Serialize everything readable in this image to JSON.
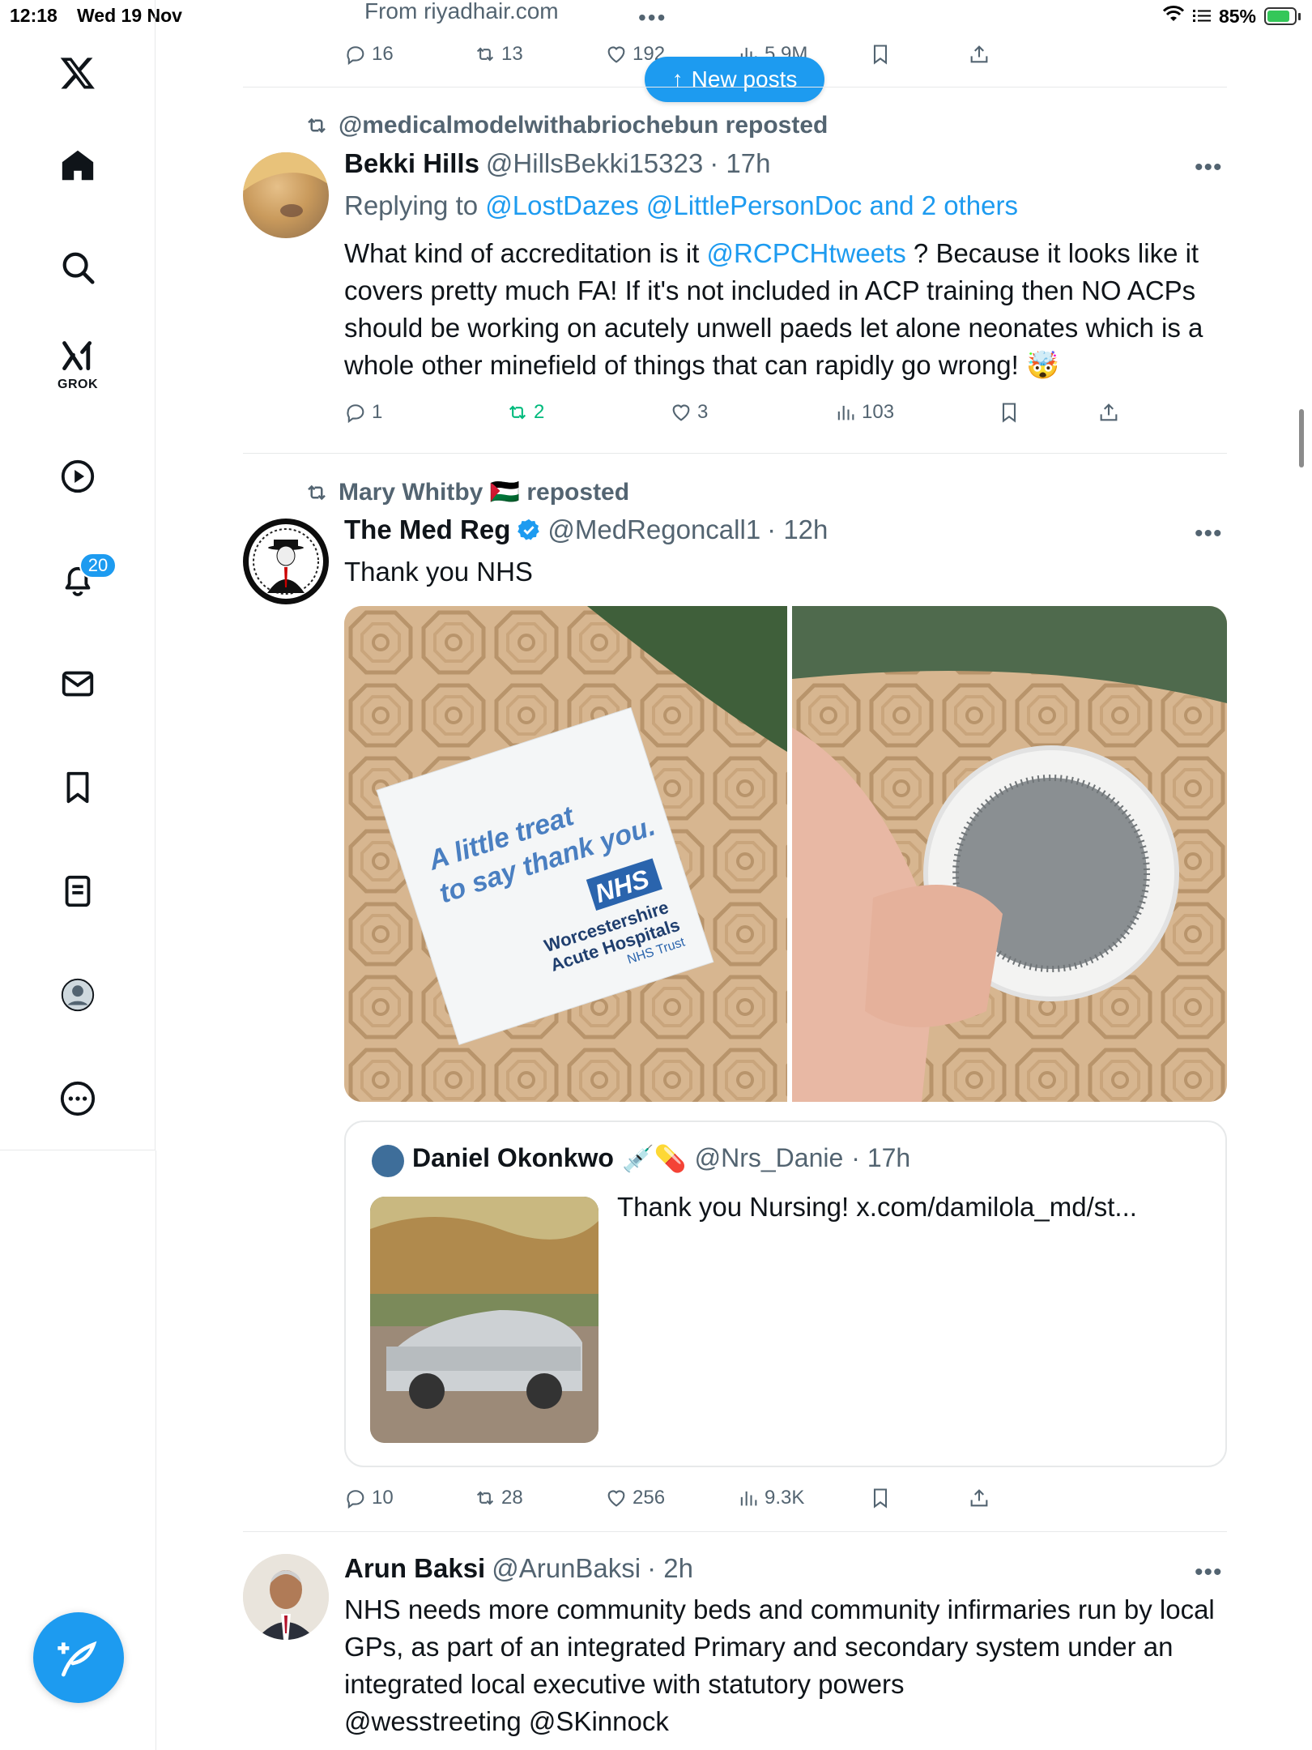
{
  "status": {
    "time": "12:18",
    "date": "Wed 19 Nov",
    "battery": "85%",
    "battery_level": 0.85
  },
  "sidebar": {
    "grok_label": "GROK",
    "notifications_badge": "20"
  },
  "top_tweet": {
    "source": "From riyadhair.com",
    "replies": "16",
    "reposts": "13",
    "likes": "192",
    "views": "5.9M"
  },
  "new_posts": "New posts",
  "tweet1": {
    "repost_by": "@medicalmodelwithabriochebun reposted",
    "name": "Bekki Hills",
    "handle": "@HillsBekki15323",
    "time": "· 17h",
    "reply_prefix": "Replying to",
    "reply_to": "@LostDazes @LittlePersonDoc and 2 others",
    "text_a": "What kind of accreditation is it ",
    "text_mention": "@RCPCHtweets",
    "text_b": " ? Because it looks like it covers pretty much FA! If it's not included in ACP training then NO ACPs should be working on acutely unwell paeds let alone neonates which is a whole other minefield of things that can rapidly go wrong! 🤯",
    "replies": "1",
    "reposts": "2",
    "likes": "3",
    "views": "103"
  },
  "tweet2": {
    "repost_by": "Mary Whitby 🇵🇸 reposted",
    "name": "The Med Reg",
    "handle": "@MedRegoncall1",
    "time": "· 12h",
    "text": "Thank you NHS",
    "card_line1": "A little treat",
    "card_line2": "to say thank you.",
    "card_logo": "NHS",
    "card_org1": "Worcestershire",
    "card_org2": "Acute Hospitals",
    "card_org3": "NHS Trust",
    "quote": {
      "name": "Daniel Okonkwo",
      "emojis": "💉💊",
      "handle": "@Nrs_Danie",
      "time": "· 17h",
      "text": "Thank you Nursing! x.com/damilola_md/st..."
    },
    "replies": "10",
    "reposts": "28",
    "likes": "256",
    "views": "9.3K"
  },
  "tweet3": {
    "name": "Arun Baksi",
    "handle": "@ArunBaksi",
    "time": "· 2h",
    "text": "NHS needs more community beds and community infirmaries run by local GPs, as part of an integrated Primary and secondary system under an integrated local executive with statutory powers",
    "mentions": "@wesstreeting @SKinnock"
  },
  "more_label": "•••"
}
